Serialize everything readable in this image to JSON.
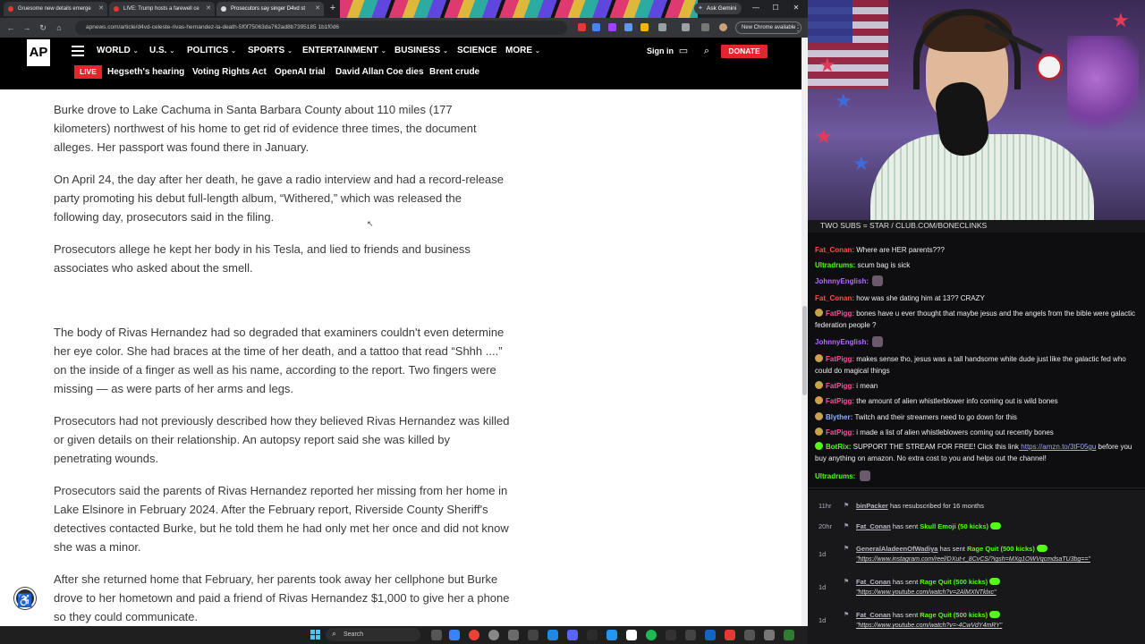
{
  "browser": {
    "tabs": [
      {
        "label": "Gruesome new details emerge"
      },
      {
        "label": "LIVE: Trump hosts a farewell ce"
      },
      {
        "label": "Prosecutors say singer D4vd st"
      }
    ],
    "gemini_label": "Ask Gemini",
    "url": "apnews.com/article/d4vd-celeste-rivas-hernandez-la-death-5f0f75063da762ad8b7395185 1b1f0d6",
    "chrome_available": "New Chrome available"
  },
  "ap": {
    "logo": "AP",
    "nav": [
      {
        "label": "WORLD",
        "chev": "⌄"
      },
      {
        "label": "U.S.",
        "chev": "⌄"
      },
      {
        "label": "POLITICS",
        "chev": "⌄"
      },
      {
        "label": "SPORTS",
        "chev": "⌄"
      },
      {
        "label": "ENTERTAINMENT",
        "chev": "⌄"
      },
      {
        "label": "BUSINESS",
        "chev": "⌄"
      },
      {
        "label": "SCIENCE",
        "chev": ""
      },
      {
        "label": "MORE",
        "chev": "⌄"
      }
    ],
    "sign_in": "Sign in",
    "donate": "DONATE",
    "live": "LIVE",
    "trending": [
      "Hegseth's hearing",
      "Voting Rights Act",
      "OpenAI trial",
      "David Allan Coe dies",
      "Brent crude"
    ]
  },
  "article": {
    "p1": "Burke drove to Lake Cachuma in Santa Barbara County about 110 miles (177 kilometers) northwest of his home to get rid of evidence three times, the document alleges. Her passport was found there in January.",
    "p2": "On April 24, the day after her death, he gave a radio interview and had a record-release party promoting his debut full-length album, “Withered,” which was released the following day, prosecutors said in the filing.",
    "p3": "Prosecutors allege he kept her body in his Tesla, and lied to friends and business associates who asked about the smell.",
    "p4": "The body of Rivas Hernandez had so degraded that examiners couldn't even determine her eye color. She had braces at the time of her death, and a tattoo that read “Shhh ....” on the inside of a finger as well as his name, according to the report. Two fingers were missing — as were parts of her arms and legs.",
    "p5": "Prosecutors had not previously described how they believed Rivas Hernandez was killed or given details on their relationship. An autopsy report said she was killed by penetrating wounds.",
    "p6": "Prosecutors said the parents of Rivas Hernandez reported her missing from her home in Lake Elsinore in February 2024. After the February report, Riverside County Sheriff's detectives contacted Burke, but he told them he had only met her once and did not know she was a minor.",
    "p7": "After she returned home that February, her parents took away her cellphone but Burke drove to her hometown and paid a friend of Rivas Hernandez $1,000 to give her a phone so they could communicate."
  },
  "taskbar": {
    "search": "Search"
  },
  "stream": {
    "header": "TWO SUBS = STAR / CLUB.COM/BONECLINKS",
    "chat": [
      {
        "user": "Fat_Conan:",
        "text": "Where are HER parents???",
        "color": "#ff4d4d"
      },
      {
        "user": "Ultradrums:",
        "text": "scum bag is sick",
        "color": "#53fc18"
      },
      {
        "user": "JohnnyEnglish:",
        "text": "",
        "color": "#b46bff"
      },
      {
        "user": "Fat_Conan:",
        "text": "how was she dating him at 13?? CRAZY",
        "color": "#ff4d4d"
      },
      {
        "user": "FatPigg:",
        "text": "bones have u ever thought that maybe jesus and the angels from the bible were galactic federation people ?",
        "color": "#ff4d9a"
      },
      {
        "user": "JohnnyEnglish:",
        "text": "",
        "color": "#b46bff"
      },
      {
        "user": "FatPigg:",
        "text": "makes sense tho, jesus was a tall handsome white dude just like the galactic fed who could do magical things",
        "color": "#ff4d9a"
      },
      {
        "user": "FatPigg:",
        "text": "i mean",
        "color": "#ff4d9a"
      },
      {
        "user": "FatPigg:",
        "text": "the amount of alien whistlerblower info coming out is wild bones",
        "color": "#ff4d9a"
      },
      {
        "user": "Blyther:",
        "text": "Twitch and their streamers need to go down for this",
        "color": "#8fb0ff"
      },
      {
        "user": "FatPigg:",
        "text": "i made a list of alien whistleblowers coming out recently bones",
        "color": "#ff4d9a"
      },
      {
        "user": "BotRix:",
        "text": "SUPPORT THE STREAM FOR FREE! Click this link",
        "link": "https://amzn.to/3tF05gu",
        "text2": "before you buy anything on amazon. No extra cost to you and helps out the channel!",
        "color": "#53fc18"
      },
      {
        "user": "Ultradrums:",
        "text": "",
        "color": "#53fc18"
      }
    ],
    "events": [
      {
        "time": "11hr",
        "user": "binPacker",
        "text": "has resubscribed for 16 months",
        "gift": "",
        "url": ""
      },
      {
        "time": "20hr",
        "user": "Fat_Conan",
        "text": "has sent",
        "gift": "Skull Emoji (50 kicks)",
        "url": ""
      },
      {
        "time": "1d",
        "user": "GeneralAladeenOfWadiya",
        "text": "has sent",
        "gift": "Rage Quit (500 kicks)",
        "url": "\"https://www.instagram.com/reel/DXut-r_8CvCS/?igsh=MXg1OWVqcmdsaTU3bg==\""
      },
      {
        "time": "1d",
        "user": "Fat_Conan",
        "text": "has sent",
        "gift": "Rage Quit (500 kicks)",
        "url": "\"https://www.youtube.com/watch?v=2AlMXNTklxc\""
      },
      {
        "time": "1d",
        "user": "Fat_Conan",
        "text": "has sent",
        "gift": "Rage Quit (500 kicks)",
        "url": "\"https://www.youtube.com/watch?v=-4CwVdY4mRY\""
      }
    ]
  }
}
